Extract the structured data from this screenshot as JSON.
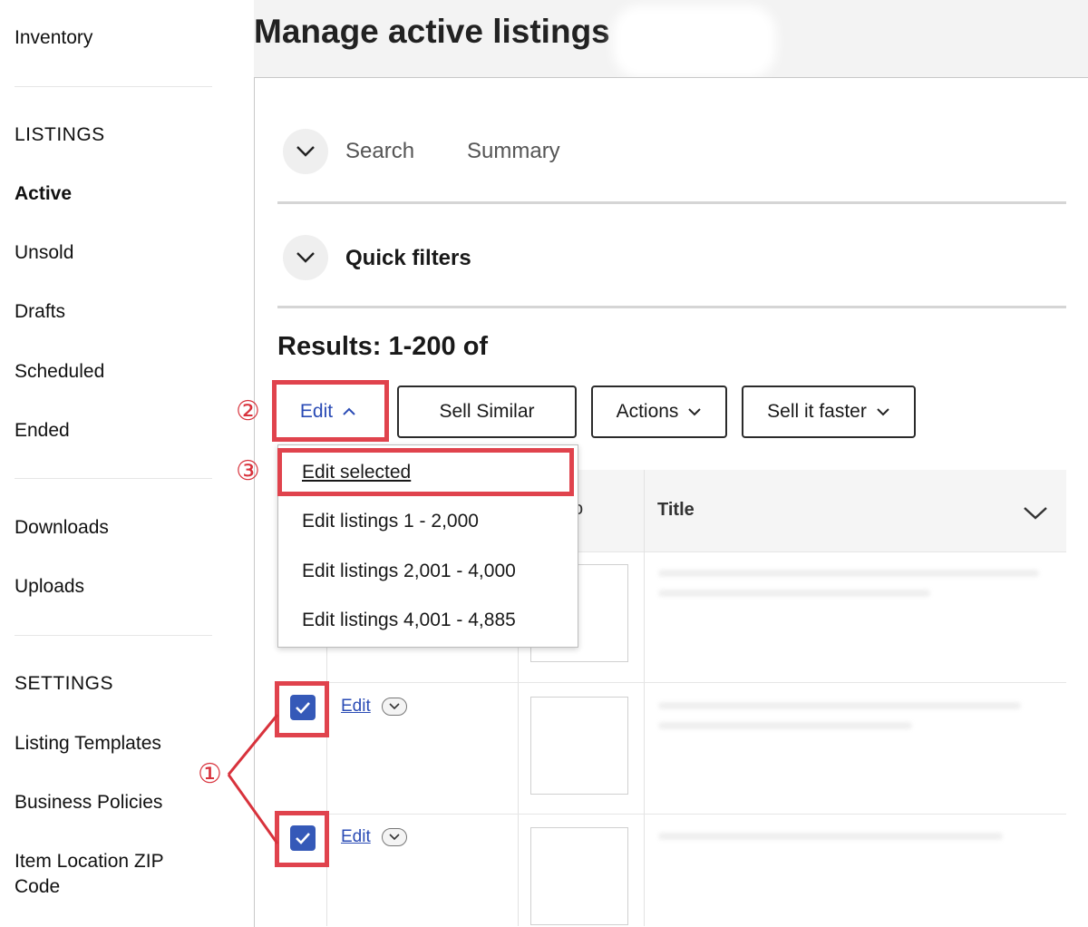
{
  "sidebar": {
    "inventory": "Inventory",
    "listings_heading": "LISTINGS",
    "active": "Active",
    "unsold": "Unsold",
    "drafts": "Drafts",
    "scheduled": "Scheduled",
    "ended": "Ended",
    "downloads": "Downloads",
    "uploads": "Uploads",
    "settings_heading": "SETTINGS",
    "listing_templates": "Listing Templates",
    "business_policies": "Business Policies",
    "item_location_line1": "Item Location ZIP",
    "item_location_line2": "Code"
  },
  "page": {
    "title": "Manage active listings"
  },
  "sections": {
    "search": "Search",
    "summary": "Summary",
    "quick_filters": "Quick filters"
  },
  "results": {
    "label": "Results: 1-200 of"
  },
  "toolbar": {
    "edit": "Edit",
    "sell_similar": "Sell Similar",
    "actions": "Actions",
    "sell_it_faster": "Sell it faster"
  },
  "edit_menu": {
    "items": [
      "Edit selected",
      "Edit listings 1 - 2,000",
      "Edit listings 2,001 - 4,000",
      "Edit listings 4,001 - 4,885"
    ]
  },
  "table": {
    "photo_header_fragment": "o",
    "title_header": "Title",
    "rows": [
      {
        "edit_label": "Edit"
      },
      {
        "edit_label": "Edit"
      }
    ]
  },
  "annotations": {
    "one": "①",
    "two": "②",
    "three": "③"
  },
  "colors": {
    "annotation_red": "#e0434d",
    "link_blue": "#2a4bb5",
    "checkbox_blue": "#3559b8"
  }
}
